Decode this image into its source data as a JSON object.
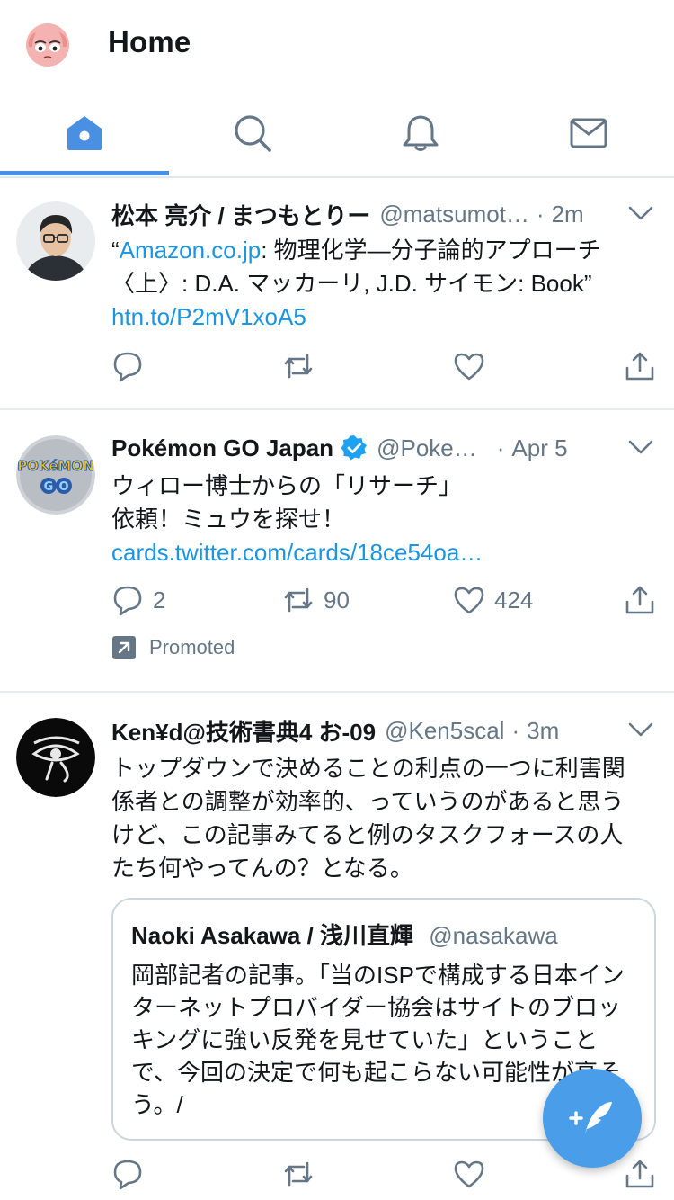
{
  "header": {
    "title": "Home"
  },
  "tabs": [
    {
      "name": "home",
      "icon": "home-icon",
      "active": true
    },
    {
      "name": "search",
      "icon": "search-icon",
      "active": false
    },
    {
      "name": "notifications",
      "icon": "bell-icon",
      "active": false
    },
    {
      "name": "messages",
      "icon": "mail-icon",
      "active": false
    }
  ],
  "colors": {
    "accent": "#4a90e2",
    "link": "#1b95e0",
    "muted": "#657786",
    "verified": "#1da1f2"
  },
  "tweets": [
    {
      "name": "松本 亮介 / まつもとりー",
      "handle": "@matsumot…",
      "time": "2m",
      "body_prefix": "“",
      "body_link1": "Amazon.co.jp",
      "body_text": ": 物理化学―分子論的アプローチ〈上〉: D.A. マッカーリ, J.D. サイモン: Book”",
      "body_link2": "htn.to/P2mV1xoA5",
      "counts": {
        "reply": "",
        "retweet": "",
        "like": ""
      }
    },
    {
      "name": "Pokémon GO Japan",
      "verified": true,
      "handle": "@Poke…",
      "time": "Apr 5",
      "body_line1": "ウィロー博士からの「リサーチ」",
      "body_line2": "依頼！ミュウを探せ！",
      "body_link": "cards.twitter.com/cards/18ce54oa…",
      "counts": {
        "reply": "2",
        "retweet": "90",
        "like": "424"
      },
      "promoted_label": "Promoted"
    },
    {
      "name": "Ken¥d@技術書典4 お-09",
      "handle": "@Ken5scal",
      "time": "3m",
      "body": "トップダウンで決めることの利点の一つに利害関係者との調整が効率的、っていうのがあると思うけど、この記事みてると例のタスクフォースの人たち何やってんの？となる。",
      "quote": {
        "name": "Naoki Asakawa / 浅川直輝",
        "handle": "@nasakawa",
        "body": "岡部記者の記事。「当のISPで構成する日本インターネットプロバイダー協会はサイトのブロッキングに強い反発を見せていた」ということで、今回の決定で何も起こらない可能性が高そう。/"
      }
    }
  ],
  "sep": "·"
}
